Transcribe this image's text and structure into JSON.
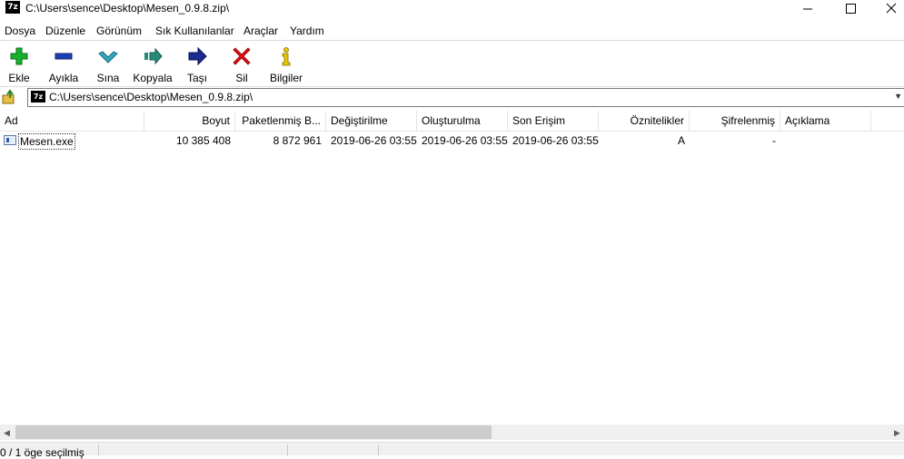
{
  "window": {
    "title": "C:\\Users\\sence\\Desktop\\Mesen_0.9.8.zip\\",
    "app_icon": "7z"
  },
  "menu": [
    "Dosya",
    "Düzenle",
    "Görünüm",
    "Sık Kullanılanlar",
    "Araçlar",
    "Yardım"
  ],
  "toolbar": [
    {
      "label": "Ekle",
      "icon": "plus-icon",
      "color": "#16b02a"
    },
    {
      "label": "Ayıkla",
      "icon": "minus-icon",
      "color": "#1f3fb0"
    },
    {
      "label": "Sına",
      "icon": "check-icon",
      "color": "#30a8c0"
    },
    {
      "label": "Kopyala",
      "icon": "copy-arrow-icon",
      "color": "#2a8a7a"
    },
    {
      "label": "Taşı",
      "icon": "move-arrow-icon",
      "color": "#1a2a90"
    },
    {
      "label": "Sil",
      "icon": "delete-x-icon",
      "color": "#e01010"
    },
    {
      "label": "Bilgiler",
      "icon": "info-icon",
      "color": "#e8c800"
    }
  ],
  "address": {
    "path": "C:\\Users\\sence\\Desktop\\Mesen_0.9.8.zip\\",
    "icon": "7z"
  },
  "columns": [
    "Ad",
    "Boyut",
    "Paketlenmiş B...",
    "Değiştirilme",
    "Oluşturulma",
    "Son Erişim",
    "Öznitelikler",
    "Şifrelenmiş",
    "Açıklama"
  ],
  "files": [
    {
      "name": "Mesen.exe",
      "size": "10 385 408",
      "packed": "8 872 961",
      "modified": "2019-06-26 03:55",
      "created": "2019-06-26 03:55",
      "accessed": "2019-06-26 03:55",
      "attributes": "A",
      "encrypted": "-",
      "comment": ""
    }
  ],
  "status": {
    "selection": "0 / 1 öge seçilmiş"
  }
}
